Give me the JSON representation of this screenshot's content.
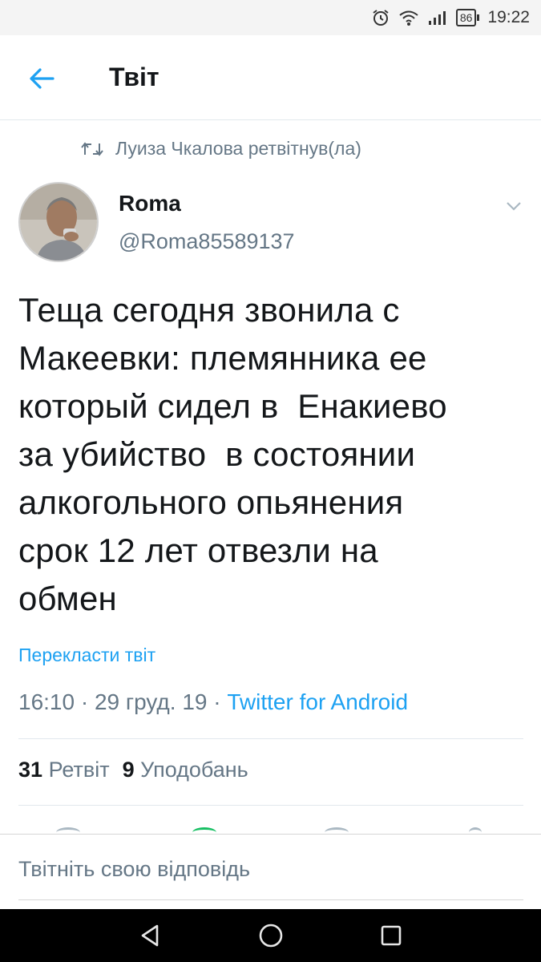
{
  "status_bar": {
    "battery": "86",
    "time": "19:22",
    "icons": [
      "alarm-icon",
      "wifi-icon",
      "signal-icon",
      "battery-icon"
    ]
  },
  "header": {
    "title": "Твіт",
    "back_icon": "back-arrow-icon"
  },
  "retweet": {
    "text": "Луиза Чкалова ретвітнув(ла)",
    "icon": "retweet-icon"
  },
  "author": {
    "name": "Roma",
    "handle": "@Roma85589137"
  },
  "tweet": {
    "text": "Теща сегодня звонила с\nМакеевки: племянника ее\nкоторый сидел в  Енакиево\nза убийство  в состоянии\nалкогольного опьянения\nсрок 12 лет отвезли на\nобмен",
    "translate_label": "Перекласти твіт",
    "time": "16:10",
    "separator": " · ",
    "date": "29 груд. 19",
    "source": "Twitter for Android"
  },
  "stats": {
    "retweets_count": "31",
    "retweets_label": "Ретвіт",
    "likes_count": "9",
    "likes_label": "Уподобань"
  },
  "reply": {
    "placeholder": "Твітніть свою відповідь"
  },
  "colors": {
    "accent": "#1da1f2",
    "secondary_text": "#657786",
    "primary_text": "#14171a",
    "divider": "#e1e8ed"
  },
  "nav_bar": {
    "icons": [
      "nav-back-icon",
      "nav-home-icon",
      "nav-recents-icon"
    ]
  }
}
